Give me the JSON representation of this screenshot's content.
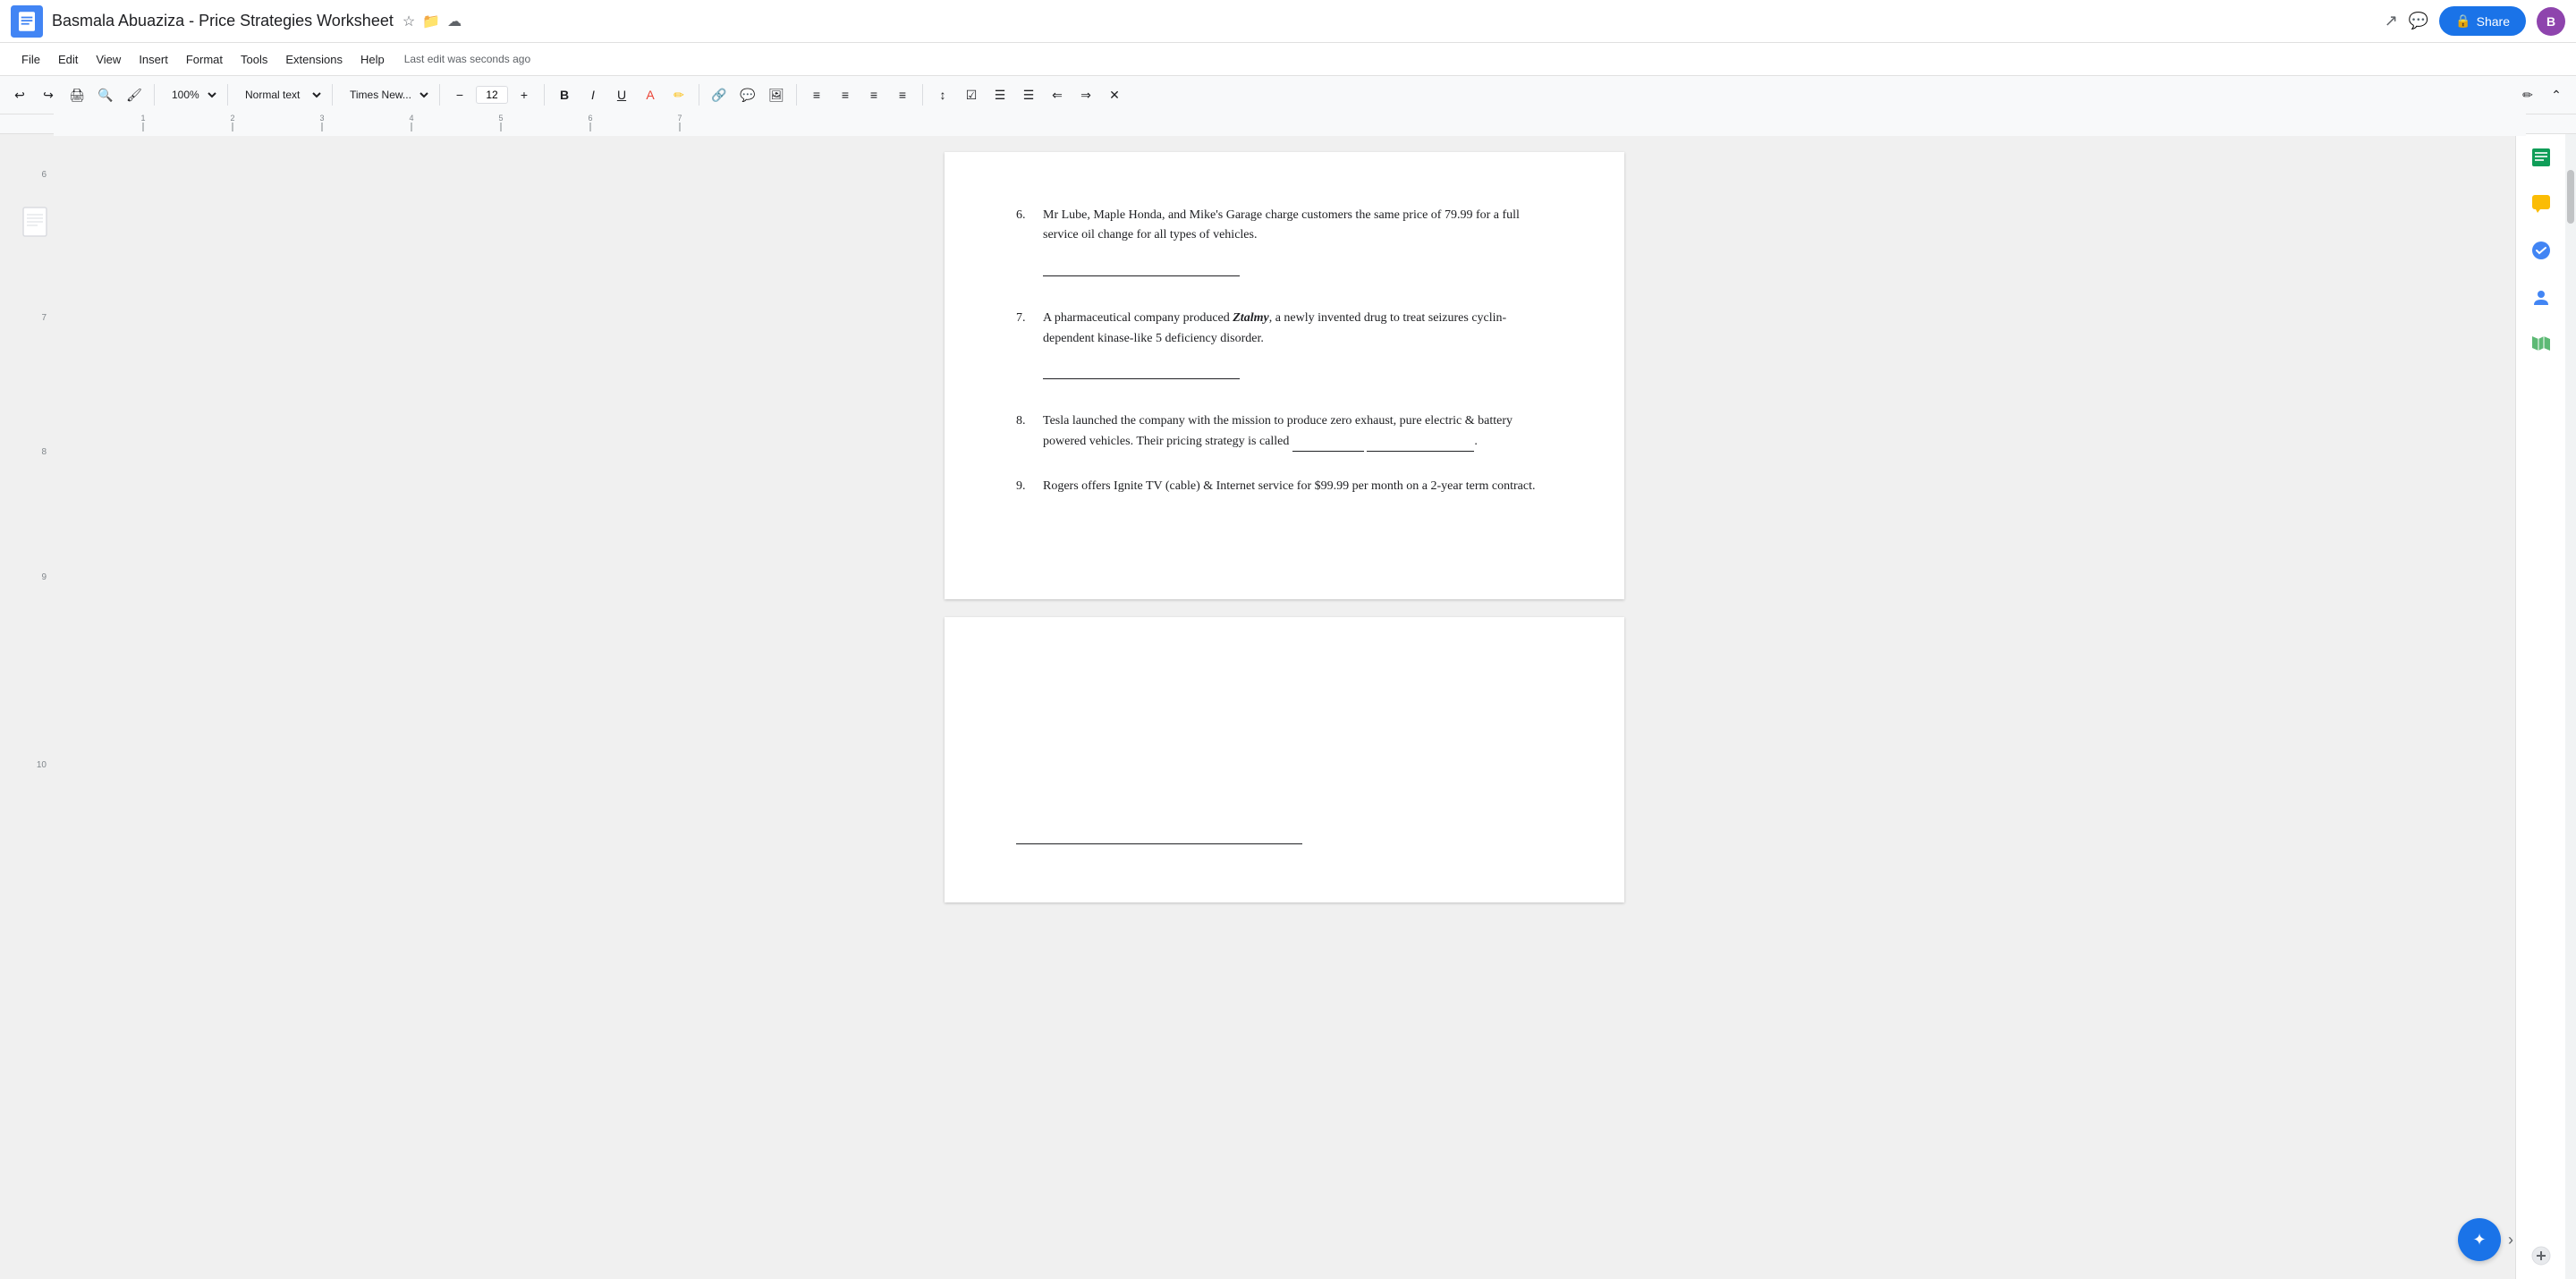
{
  "app": {
    "icon_color": "#1a73e8",
    "title": "Basmala Abuaziza - Price Strategies Worksheet",
    "last_edit": "Last edit was seconds ago",
    "share_label": "Share"
  },
  "menu": {
    "items": [
      "File",
      "Edit",
      "View",
      "Insert",
      "Format",
      "Tools",
      "Extensions",
      "Help"
    ]
  },
  "toolbar": {
    "zoom": "100%",
    "style": "Normal text",
    "font": "Times New...",
    "font_size": "12",
    "undo_label": "↩",
    "redo_label": "↪",
    "print_label": "🖨",
    "paint_format": "🖌",
    "bold_label": "B",
    "italic_label": "I",
    "underline_label": "U"
  },
  "document": {
    "items": [
      {
        "number": "6.",
        "text": "Mr Lube, Maple Honda, and Mike's Garage charge customers the same price of 79.99 for a full service oil change for all types of vehicles.",
        "has_answer_line": true
      },
      {
        "number": "7.",
        "text_before": "A pharmaceutical company produced ",
        "drug_name": "Ztalmy",
        "text_after": ", a newly invented drug to treat seizures cyclin-dependent kinase-like 5 deficiency disorder.",
        "has_answer_line": true
      },
      {
        "number": "8.",
        "text_before": "Tesla launched the company with the mission to produce zero exhaust, pure electric & battery powered vehicles. Their pricing strategy is called ",
        "blank1": "___________",
        "blank2": "______________",
        "text_after": "."
      },
      {
        "number": "9.",
        "text": "Rogers offers Ignite TV (cable) & Internet service for $99.99 per month on a 2-year term contract."
      }
    ]
  },
  "sidebar": {
    "icons": [
      "📊",
      "💬",
      "✅",
      "👤",
      "🗺️"
    ]
  },
  "page2": {
    "has_answer_line": true
  }
}
